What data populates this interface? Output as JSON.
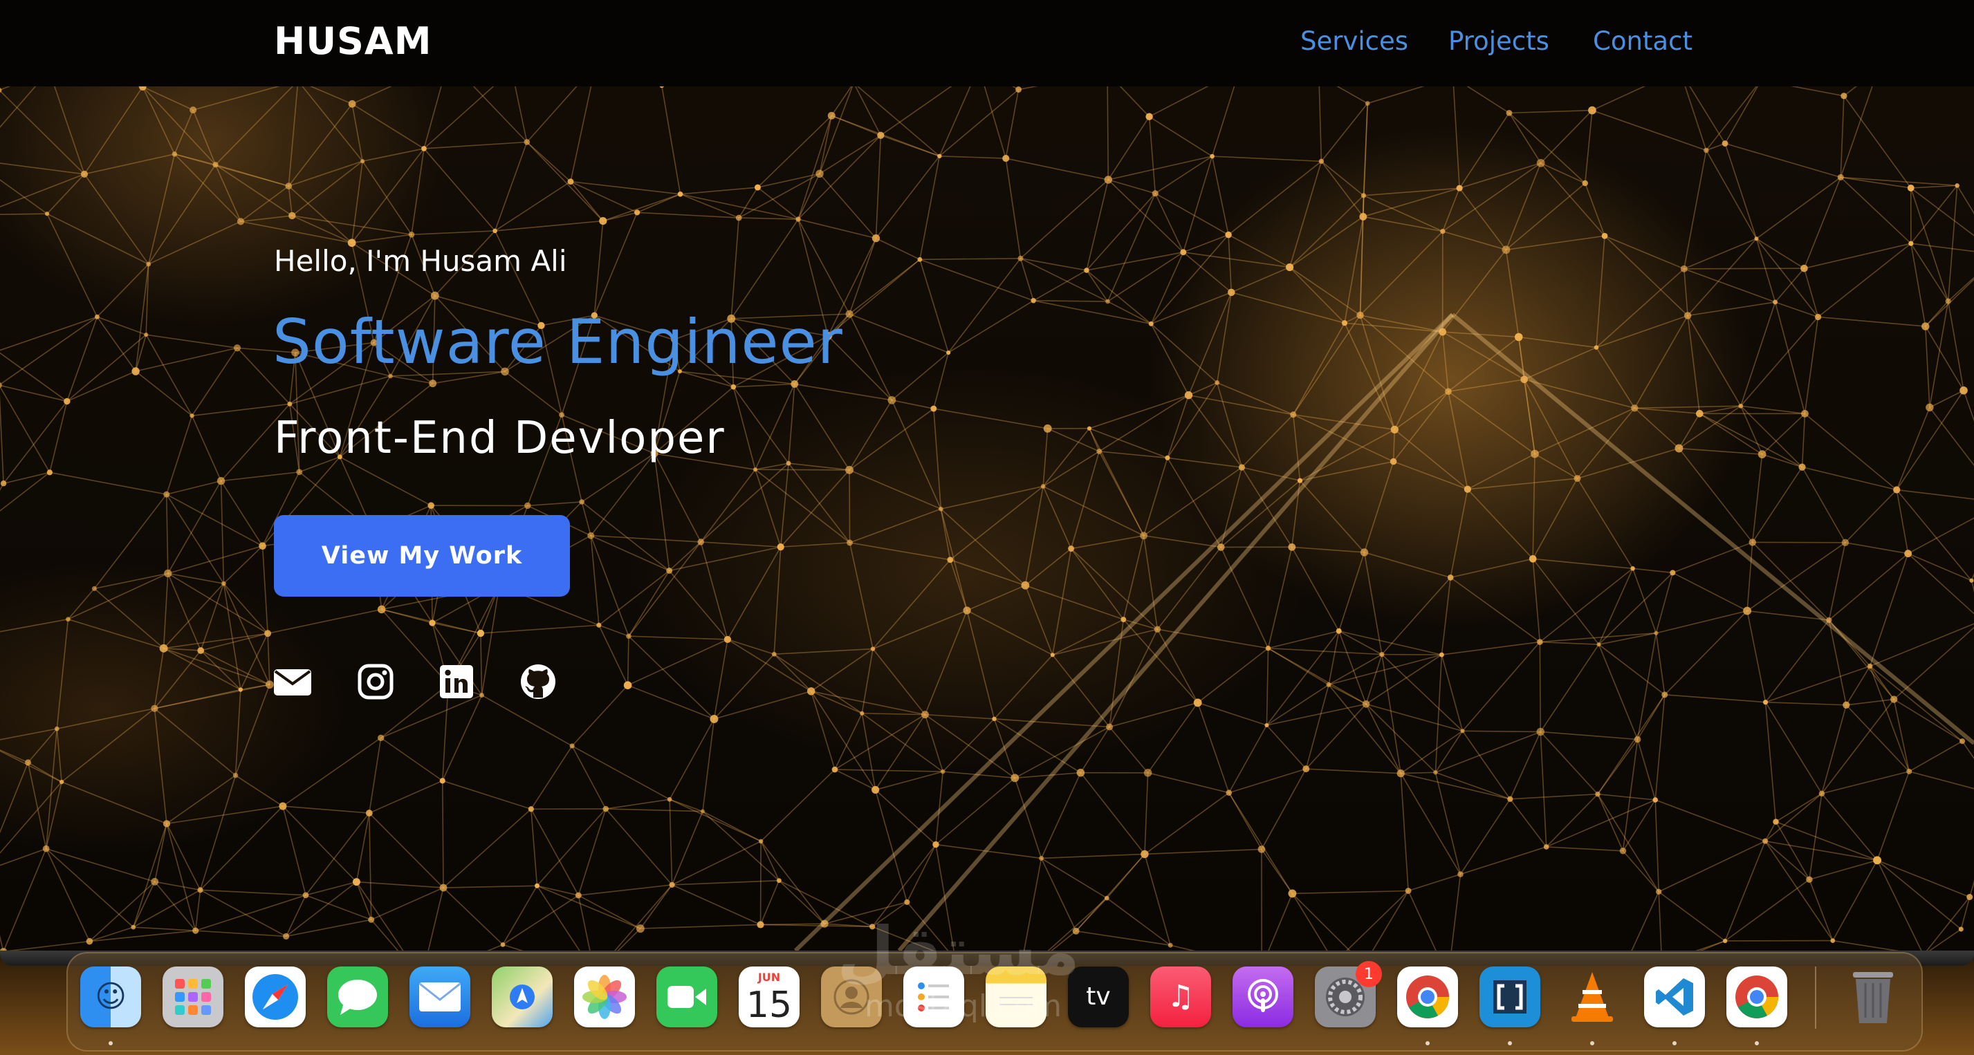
{
  "nav": {
    "brand": "HUSAM",
    "links": [
      "Services",
      "Projects",
      "Contact"
    ]
  },
  "hero": {
    "greeting": "Hello, I'm Husam Ali",
    "title": "Software Engineer",
    "subtitle": "Front-End Devloper",
    "cta_label": "View My Work",
    "social_icons": [
      "envelope-icon",
      "instagram-icon",
      "linkedin-icon",
      "github-icon"
    ]
  },
  "colors": {
    "accent_blue": "#4a90e2",
    "button_blue": "#3b6ef2",
    "network_gold": "#f0b050"
  },
  "dock": {
    "apps": [
      "finder-icon",
      "launchpad-icon",
      "safari-icon",
      "messages-icon",
      "mail-icon",
      "maps-icon",
      "photos-icon",
      "facetime-icon",
      "calendar-icon",
      "contacts-icon",
      "reminders-icon",
      "notes-icon",
      "appletv-icon",
      "music-icon",
      "podcasts-icon",
      "system-settings-icon",
      "chrome-icon",
      "brackets-icon",
      "vlc-icon",
      "vscode-icon",
      "chrome-icon",
      "trash-icon"
    ],
    "calendar_month": "JUN",
    "calendar_day": "15",
    "tv_label": "tv",
    "settings_badge": "1"
  },
  "watermark": {
    "arabic": "مستقل",
    "latin": "mostaql.com"
  }
}
